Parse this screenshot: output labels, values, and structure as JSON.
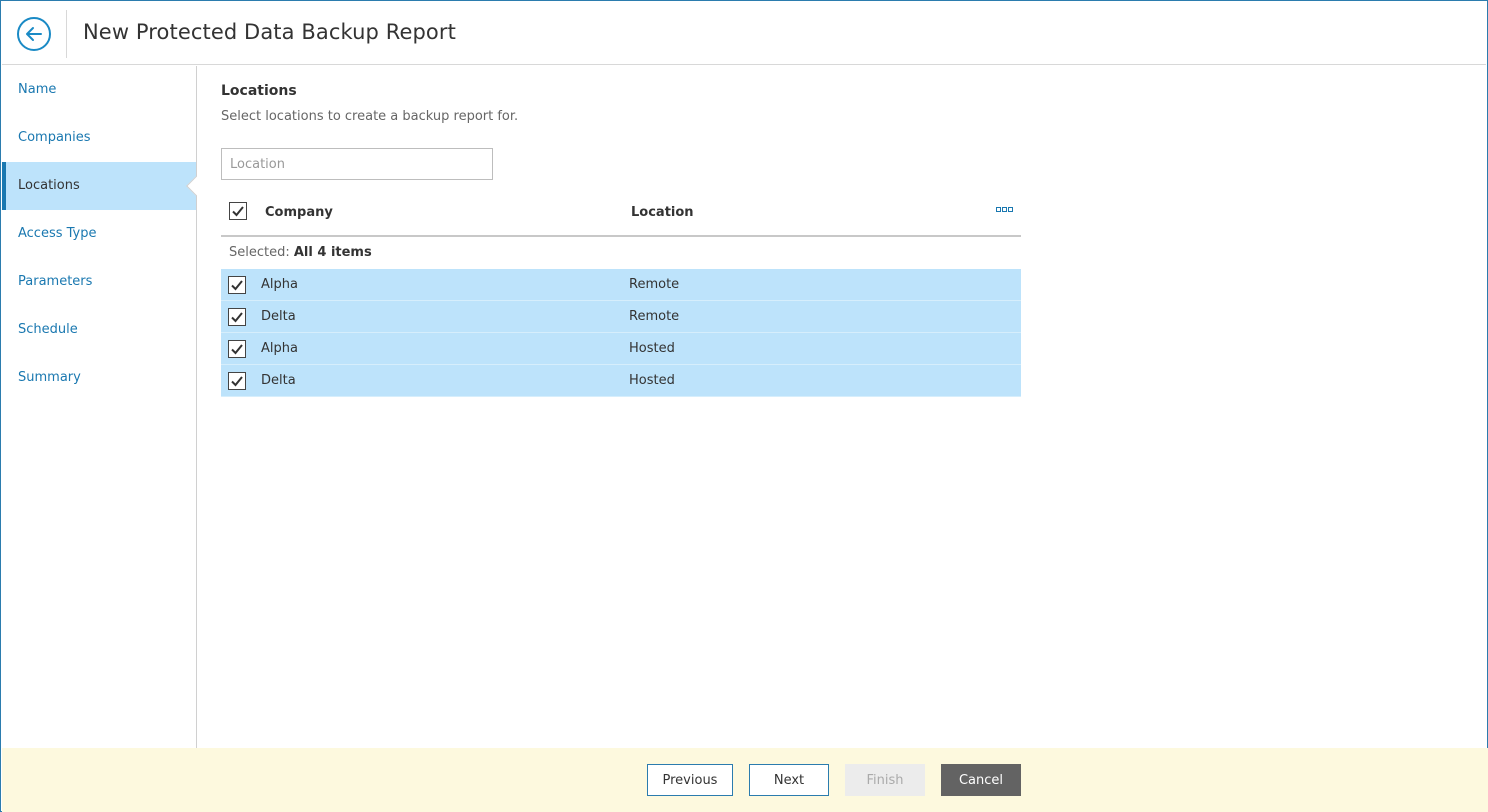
{
  "header": {
    "title": "New Protected Data Backup Report"
  },
  "sidebar": {
    "steps": [
      {
        "label": "Name"
      },
      {
        "label": "Companies"
      },
      {
        "label": "Locations"
      },
      {
        "label": "Access Type"
      },
      {
        "label": "Parameters"
      },
      {
        "label": "Schedule"
      },
      {
        "label": "Summary"
      }
    ],
    "active": "Locations"
  },
  "main": {
    "title": "Locations",
    "description": "Select locations to create a backup report for.",
    "search": {
      "placeholder": "Location",
      "value": ""
    },
    "grid": {
      "columns": {
        "company": "Company",
        "location": "Location"
      },
      "selected_prefix": "Selected:",
      "selected_value": "All 4 items",
      "rows": [
        {
          "company": "Alpha",
          "location": "Remote",
          "checked": true
        },
        {
          "company": "Delta",
          "location": "Remote",
          "checked": true
        },
        {
          "company": "Alpha",
          "location": "Hosted",
          "checked": true
        },
        {
          "company": "Delta",
          "location": "Hosted",
          "checked": true
        }
      ]
    }
  },
  "footer": {
    "previous": "Previous",
    "next": "Next",
    "finish": "Finish",
    "cancel": "Cancel"
  },
  "icons": {
    "back": "back-arrow-icon",
    "check": "checkmark-icon",
    "column_menu": "column-options-icon"
  },
  "colors": {
    "accent": "#1a78b0",
    "selection": "#bde3fb",
    "footer_bg": "#fdf9de",
    "cancel_bg": "#636363"
  }
}
